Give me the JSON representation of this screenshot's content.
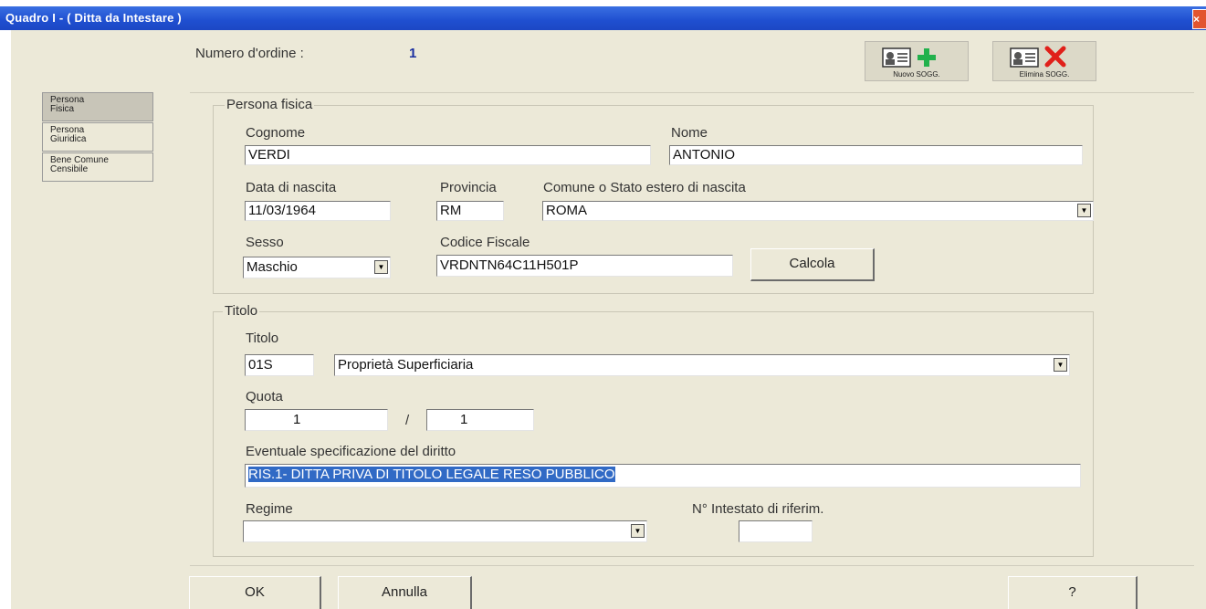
{
  "window": {
    "title": "Quadro I - ( Ditta da Intestare )",
    "close_glyph": "×"
  },
  "header": {
    "order_label": "Numero d'ordine :",
    "order_value": "1",
    "new_button": "Nuovo SOGG.",
    "delete_button": "Elimina SOGG."
  },
  "tabs": [
    {
      "line1": "Persona",
      "line2": "Fisica",
      "selected": true
    },
    {
      "line1": "Persona",
      "line2": "Giuridica",
      "selected": false
    },
    {
      "line1": "Bene Comune",
      "line2": "Censibile",
      "selected": false
    }
  ],
  "persona": {
    "group_label": "Persona fisica",
    "cognome_label": "Cognome",
    "cognome_value": "VERDI",
    "nome_label": "Nome",
    "nome_value": "ANTONIO",
    "data_label": "Data di nascita",
    "data_value": "11/03/1964",
    "provincia_label": "Provincia",
    "provincia_value": "RM",
    "comune_label": "Comune o Stato estero di nascita",
    "comune_value": "ROMA",
    "sesso_label": "Sesso",
    "sesso_value": "Maschio",
    "cf_label": "Codice Fiscale",
    "cf_value": "VRDNTN64C11H501P",
    "calcola_button": "Calcola"
  },
  "titolo": {
    "group_label": "Titolo",
    "titolo_label": "Titolo",
    "codice_value": "01S",
    "descr_value": "Proprietà Superficiaria",
    "quota_label": "Quota",
    "quota_num": "1",
    "quota_sep": "/",
    "quota_den": "1",
    "spec_label": "Eventuale specificazione del diritto",
    "spec_value": "RIS.1- DITTA PRIVA DI TITOLO LEGALE RESO PUBBLICO",
    "regime_label": "Regime",
    "regime_value": "",
    "intestato_label": "N° Intestato di riferim.",
    "intestato_value": ""
  },
  "footer": {
    "ok": "OK",
    "annulla": "Annulla",
    "help": "?"
  },
  "colors": {
    "titlebar": "#1f4fd0",
    "client_bg": "#ece9d8",
    "selection": "#316ac5",
    "plus": "#22b14c",
    "cross": "#e0201a"
  }
}
